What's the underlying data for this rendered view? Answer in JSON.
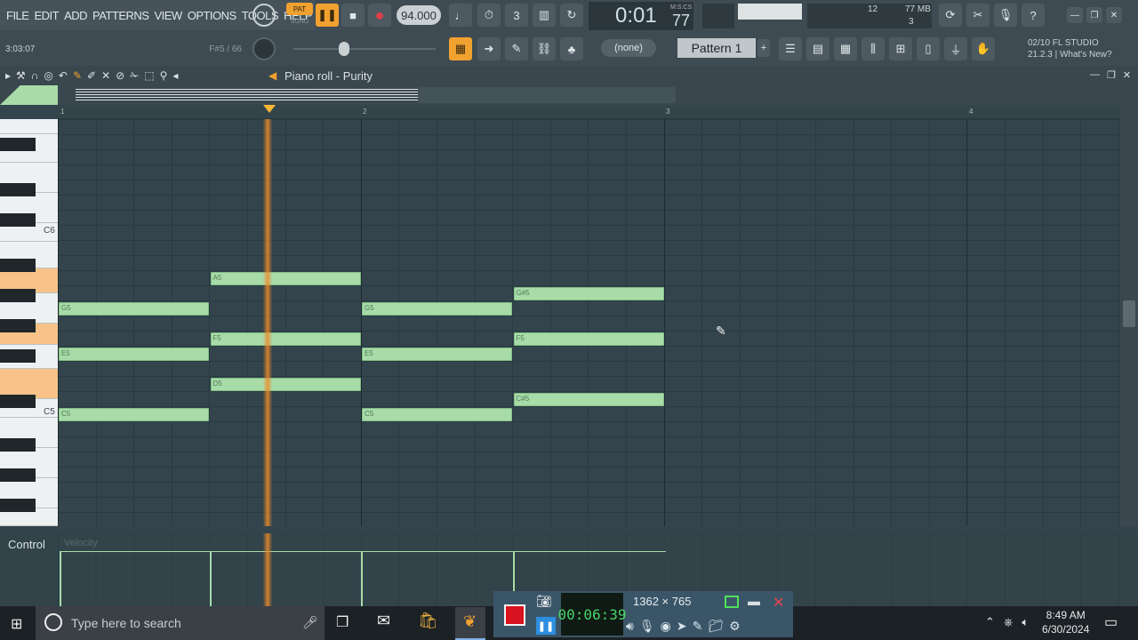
{
  "menu": [
    "FILE",
    "EDIT",
    "ADD",
    "PATTERNS",
    "VIEW",
    "OPTIONS",
    "TOOLS",
    "HELP"
  ],
  "hint": {
    "left": "3:03:07",
    "right": "F#5 / 66"
  },
  "transport": {
    "mode_pat": "PAT",
    "mode_song": "SONG",
    "tempo": "94.000",
    "time": "0:01",
    "time_sub": "77",
    "time_units": "M:S:CS"
  },
  "meters": {
    "cpu": "12",
    "mem": "77 MB",
    "poly": "3"
  },
  "pattern": {
    "none_label": "(none)",
    "name": "Pattern 1"
  },
  "news": {
    "line1": "02/10  FL STUDIO",
    "line2": "21.2.3 | What's New?"
  },
  "piano_roll": {
    "title": "Piano roll - Purity",
    "ruler": [
      "1",
      "2",
      "3",
      "4"
    ],
    "key_labels": {
      "c6": "C6",
      "c5": "C5"
    }
  },
  "notes": [
    {
      "label": "G5",
      "row": 6
    },
    {
      "label": "E5",
      "row": 9
    },
    {
      "label": "C5",
      "row": 13
    },
    {
      "label": "A5",
      "row": 4
    },
    {
      "label": "F5",
      "row": 8
    },
    {
      "label": "D5",
      "row": 11
    },
    {
      "label": "G5",
      "row": 6
    },
    {
      "label": "E5",
      "row": 9
    },
    {
      "label": "C5",
      "row": 13
    },
    {
      "label": "G#5",
      "row": 5
    },
    {
      "label": "F5",
      "row": 8
    },
    {
      "label": "C#5",
      "row": 12
    }
  ],
  "control": {
    "label": "Control",
    "sub": "Velocity"
  },
  "taskbar": {
    "search_placeholder": "Type here to search",
    "time": "8:49 AM",
    "date": "6/30/2024"
  },
  "recorder": {
    "elapsed": "00:06:39",
    "dimensions": "1362 × 765"
  },
  "colors": {
    "note": "#a8dba8",
    "accent": "#f0a130",
    "playhead": "#f08c28"
  }
}
